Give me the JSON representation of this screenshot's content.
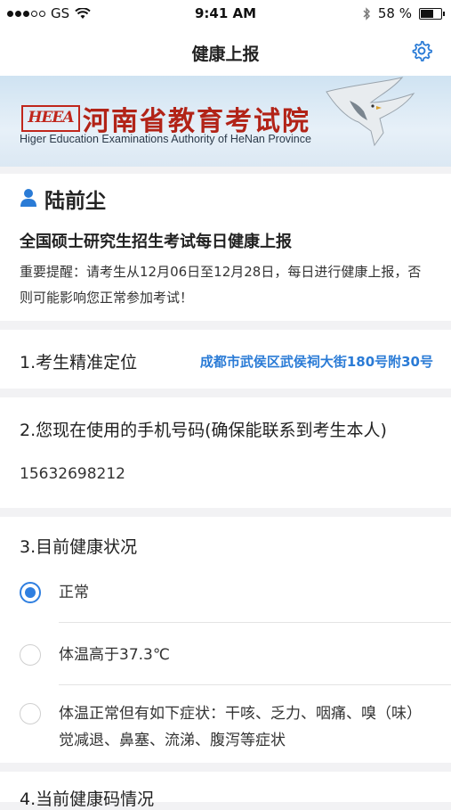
{
  "status_bar": {
    "carrier": "GS",
    "time": "9:41 AM",
    "battery": "58 %",
    "battery_level": 0.58
  },
  "nav": {
    "title": "健康上报",
    "settings_icon": "gear-icon"
  },
  "banner": {
    "logo_text": "HEEA",
    "title_cn": "河南省教育考试院",
    "title_en": "Higer Education Examinations Authority of HeNan Province"
  },
  "user": {
    "name": "陆前尘",
    "report_title": "全国硕士研究生招生考试每日健康上报",
    "notice": "重要提醒：请考生从12月06日至12月28日，每日进行健康上报，否则可能影响您正常参加考试！"
  },
  "questions": {
    "location": {
      "label": "1.考生精准定位",
      "value": "成都市武侯区武侯祠大街180号附30号"
    },
    "phone": {
      "label": "2.您现在使用的手机号码(确保能联系到考生本人)",
      "value": "15632698212"
    },
    "health": {
      "label": "3.目前健康状况",
      "options": [
        {
          "label": "正常",
          "checked": true
        },
        {
          "label": "体温高于37.3℃",
          "checked": false
        },
        {
          "label": "体温正常但有如下症状：干咳、乏力、咽痛、嗅（味）觉减退、鼻塞、流涕、腹泻等症状",
          "checked": false
        }
      ]
    },
    "health_code": {
      "label": "4.当前健康码情况"
    }
  }
}
